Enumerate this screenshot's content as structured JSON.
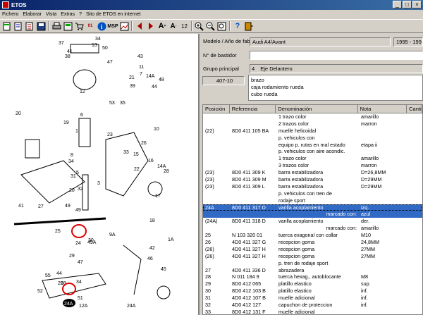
{
  "window": {
    "title": "ETOS"
  },
  "menu": [
    "Fichero",
    "Elaborar",
    "Vista",
    "Extras",
    "?",
    "Sito de ETOS en internet"
  ],
  "toolbar": {
    "zoom_value": "12"
  },
  "diagram": {
    "callouts": [
      "36",
      "35",
      "40",
      "14A",
      "34",
      "37",
      "13",
      "41",
      "48",
      "38",
      "50",
      "43",
      "47",
      "44",
      "11",
      "7",
      "14A",
      "21",
      "39",
      "12",
      "20",
      "19",
      "53",
      "35",
      "6",
      "10",
      "26",
      "15",
      "16",
      "14A",
      "1",
      "8",
      "34",
      "23",
      "33",
      "28",
      "22",
      "17",
      "18",
      "5",
      "32",
      "31",
      "3",
      "49",
      "20",
      "41",
      "49",
      "27",
      "25",
      "24",
      "30",
      "9A",
      "42",
      "45A",
      "1A",
      "29",
      "45",
      "34",
      "47",
      "46",
      "44",
      "55",
      "25",
      "28",
      "52",
      "51",
      "12A",
      "24A"
    ],
    "ref_label": "24A",
    "colors": {
      "highlight": "#e00000"
    }
  },
  "header": {
    "model_label": "Modelo / Año de fabricación",
    "model_value": "Audi A4/Avant",
    "year_value": "1995 - 199",
    "chassis_label": "N° de bastidor",
    "chassis_value": "",
    "group_label": "Grupo principal",
    "group_num": "4",
    "group_name": "Eje Delantero",
    "subgroup_code": "407-10",
    "subgroup_desc": [
      "brazo",
      "caja rodamiento rueda",
      "cubo rueda"
    ]
  },
  "table": {
    "columns": [
      "Posición",
      "Referencia",
      "Denominación",
      "Nota",
      "Canti"
    ],
    "rows": [
      {
        "pos": "",
        "ref": "",
        "name": "1 trazo color",
        "note": "amarillo"
      },
      {
        "pos": "",
        "ref": "",
        "name": "2 trazos color",
        "note": "marron"
      },
      {
        "pos": "(22)",
        "ref": "8D0 411 105 BA",
        "name": "muelle helicoidal",
        "note": ""
      },
      {
        "pos": "",
        "ref": "",
        "name": "p. vehiculos con",
        "note": ""
      },
      {
        "pos": "",
        "ref": "",
        "name": "equipo p. rutas en mal estado",
        "note": "etapa ii"
      },
      {
        "pos": "",
        "ref": "",
        "name": "p. vehiculos con aire acondic.",
        "note": ""
      },
      {
        "pos": "",
        "ref": "",
        "name": "1 trazo color",
        "note": "amarillo"
      },
      {
        "pos": "",
        "ref": "",
        "name": "3 trazos color",
        "note": "marron"
      },
      {
        "pos": "(23)",
        "ref": "8D0 411 309 K",
        "name": "barra estabilizadora",
        "note": "D=26,8MM"
      },
      {
        "pos": "(23)",
        "ref": "8D0 411 309 M",
        "name": "barra estabilizadora",
        "note": "D=29MM"
      },
      {
        "pos": "(23)",
        "ref": "8D0 411 309 L",
        "name": "barra estabilizadora",
        "note": "D=29MM"
      },
      {
        "pos": "",
        "ref": "",
        "name": "p. vehiculos con tren de",
        "note": ""
      },
      {
        "pos": "",
        "ref": "",
        "name": "rodaje sport",
        "note": ""
      },
      {
        "pos": "24A",
        "ref": "8D0 411 317 D",
        "name": "varilla acoplamiento",
        "note": "izq.",
        "selected": true
      },
      {
        "pos": "",
        "ref": "",
        "name": "marcado con:",
        "note": "azul",
        "selected": true,
        "right": true
      },
      {
        "pos": "(24A)",
        "ref": "8D0 411 318 D",
        "name": "varilla acoplamiento",
        "note": "der."
      },
      {
        "pos": "",
        "ref": "",
        "name": "marcado con:",
        "note": "amarillo",
        "right": true
      },
      {
        "pos": "25",
        "ref": "N  103 320 01",
        "name": "tuerca exagonal con collar",
        "note": "M10"
      },
      {
        "pos": "26",
        "ref": "4D0 411 327 G",
        "name": "recepcion goma",
        "note": "24,8MM"
      },
      {
        "pos": "(26)",
        "ref": "4D0 411 327 H",
        "name": "recepcion goma",
        "note": "27MM"
      },
      {
        "pos": "(26)",
        "ref": "4D0 411 327 H",
        "name": "recepcion goma",
        "note": "27MM"
      },
      {
        "pos": "",
        "ref": "",
        "name": "p. tren de rodaje sport",
        "note": ""
      },
      {
        "pos": "27",
        "ref": "4D0 411 336 D",
        "name": "abrazadera",
        "note": ""
      },
      {
        "pos": "28",
        "ref": "N  011 184 9",
        "name": "tuerca hexag., autoblocante",
        "note": "M8"
      },
      {
        "pos": "29",
        "ref": "8D0 412 065",
        "name": "platillo elastico",
        "note": "sup."
      },
      {
        "pos": "30",
        "ref": "8D0 412 103 B",
        "name": "platillo elastico",
        "note": "inf."
      },
      {
        "pos": "31",
        "ref": "4D0 412 107 B",
        "name": "muelle adicional",
        "note": "inf."
      },
      {
        "pos": "32",
        "ref": "4D0 412 127",
        "name": "capuchon de proteccion",
        "note": "inf."
      },
      {
        "pos": "33",
        "ref": "8D0 412 131 F",
        "name": "muelle adicional",
        "note": ""
      },
      {
        "pos": "",
        "ref": "8D0 412 131 E",
        "name": "muelle adicional",
        "note": ""
      }
    ]
  }
}
